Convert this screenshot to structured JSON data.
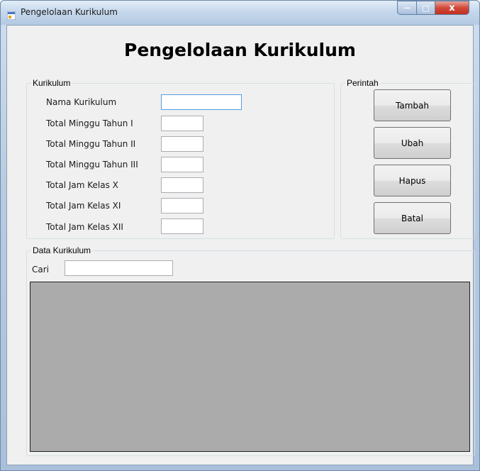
{
  "window": {
    "title": "Pengelolaan Kurikulum",
    "caption": {
      "minimize": "—",
      "maximize": "□",
      "close": "x"
    }
  },
  "form": {
    "heading": "Pengelolaan Kurikulum"
  },
  "kurikulum_group": {
    "title": "Kurikulum",
    "fields": [
      {
        "label": "Nama Kurikulum",
        "value": ""
      },
      {
        "label": "Total Minggu Tahun I",
        "value": ""
      },
      {
        "label": "Total Minggu Tahun II",
        "value": ""
      },
      {
        "label": "Total Minggu Tahun III",
        "value": ""
      },
      {
        "label": "Total Jam Kelas X",
        "value": ""
      },
      {
        "label": "Total Jam Kelas XI",
        "value": ""
      },
      {
        "label": "Total Jam Kelas XII",
        "value": ""
      }
    ]
  },
  "perintah_group": {
    "title": "Perintah",
    "buttons": [
      "Tambah",
      "Ubah",
      "Hapus",
      "Batal"
    ]
  },
  "data_group": {
    "title": "Data Kurikulum",
    "search_label": "Cari",
    "search_value": ""
  },
  "colors": {
    "grid_background": "#ababab",
    "form_background": "#f0f0f0",
    "focus_border": "#569de5"
  }
}
